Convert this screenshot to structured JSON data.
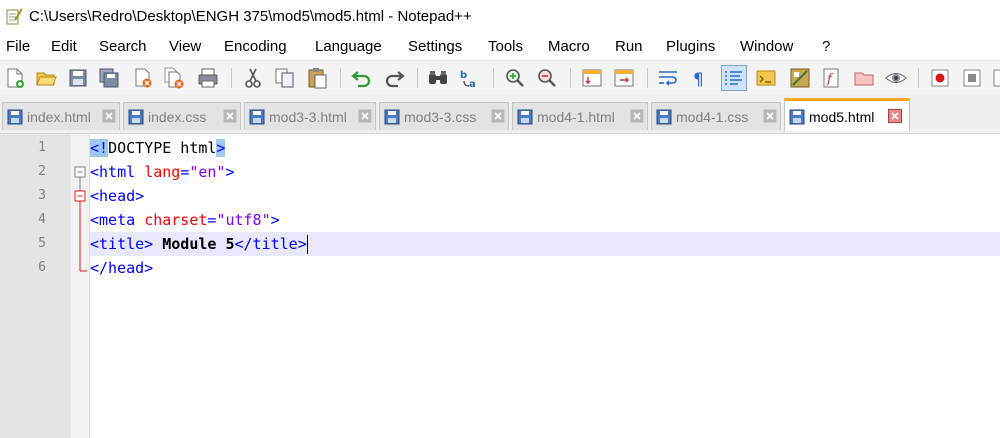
{
  "window": {
    "title": "C:\\Users\\Redro\\Desktop\\ENGH 375\\mod5\\mod5.html - Notepad++"
  },
  "menu": [
    "File",
    "Edit",
    "Search",
    "View",
    "Encoding",
    "Language",
    "Settings",
    "Tools",
    "Macro",
    "Run",
    "Plugins",
    "Window",
    "?"
  ],
  "tabs": [
    {
      "label": "index.html",
      "active": false
    },
    {
      "label": "index.css",
      "active": false
    },
    {
      "label": "mod3-3.html",
      "active": false
    },
    {
      "label": "mod3-3.css",
      "active": false
    },
    {
      "label": "mod4-1.html",
      "active": false
    },
    {
      "label": "mod4-1.css",
      "active": false
    },
    {
      "label": "mod5.html",
      "active": true
    }
  ],
  "editor": {
    "line_numbers": [
      "1",
      "2",
      "3",
      "4",
      "5",
      "6"
    ],
    "current_line": 5,
    "lines": [
      [
        {
          "t": "<!",
          "c": "tag"
        },
        {
          "t": "DOCTYPE html",
          "c": "txt-plain"
        },
        {
          "t": ">",
          "c": "tag"
        }
      ],
      [
        {
          "t": "<html ",
          "c": "tag"
        },
        {
          "t": "lang",
          "c": "attr"
        },
        {
          "t": "=",
          "c": "tag"
        },
        {
          "t": "\"en\"",
          "c": "val"
        },
        {
          "t": ">",
          "c": "tag"
        }
      ],
      [
        {
          "t": "<head>",
          "c": "tag"
        }
      ],
      [
        {
          "t": "<meta ",
          "c": "tag"
        },
        {
          "t": "charset",
          "c": "attr"
        },
        {
          "t": "=",
          "c": "tag"
        },
        {
          "t": "\"utf8\"",
          "c": "val"
        },
        {
          "t": ">",
          "c": "tag"
        }
      ],
      [
        {
          "t": "<title>",
          "c": "tag"
        },
        {
          "t": " Module 5",
          "c": "txt"
        },
        {
          "t": "</title>",
          "c": "tag"
        }
      ],
      [
        {
          "t": "</head>",
          "c": "tag"
        }
      ]
    ]
  },
  "colors": {
    "tag": "#0000ff",
    "attribute": "#ff0000",
    "value": "#8000ff",
    "active_tab_accent": "#f5a623",
    "current_line": "#e8e8ff"
  }
}
